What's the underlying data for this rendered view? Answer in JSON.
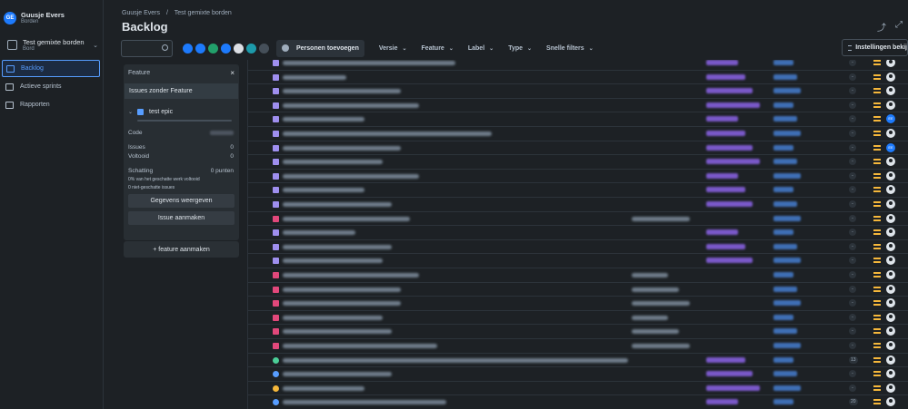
{
  "user": {
    "initials": "GE",
    "name": "Guusje Evers",
    "sub": "Borden"
  },
  "board": {
    "name": "Test gemixte borden",
    "sub": "Bord"
  },
  "nav": [
    {
      "label": "Backlog",
      "active": true
    },
    {
      "label": "Actieve sprints",
      "active": false
    },
    {
      "label": "Rapporten",
      "active": false
    }
  ],
  "breadcrumb": {
    "root": "Guusje Evers",
    "sep": "/",
    "current": "Test gemixte borden"
  },
  "page_title": "Backlog",
  "toolbar": {
    "add_people": "Personen toevoegen",
    "filters": [
      "Versie",
      "Feature",
      "Label",
      "Type",
      "Snelle filters"
    ],
    "settings": "Instellingen bekij"
  },
  "avatar_colors": [
    "#1d7afc",
    "#1d7afc",
    "#22a06b",
    "#1d7afc",
    "#dcdfe4",
    "#1d9aaa",
    "#454f59"
  ],
  "feature_panel": {
    "title": "Feature",
    "close": "×",
    "no_feature": "Issues zonder Feature",
    "epic": {
      "name": "test epic",
      "code_label": "Code",
      "issues_label": "Issues",
      "issues_value": "0",
      "done_label": "Voltooid",
      "done_value": "0",
      "estimate_label": "Schatting",
      "estimate_value": "0 punten",
      "pct_text": "0% van het geschatte werk voltooid",
      "unestimated_text": "0 niet-geschatte issues",
      "view_button": "Gegevens weergeven",
      "create_button": "Issue aanmaken"
    },
    "add_feature": "+ feature aanmaken"
  },
  "rows": [
    {
      "type": "story",
      "est": "-",
      "assignee": "default"
    },
    {
      "type": "story",
      "est": "-",
      "assignee": "default"
    },
    {
      "type": "story",
      "est": "-",
      "assignee": "default"
    },
    {
      "type": "story",
      "est": "-",
      "assignee": "default"
    },
    {
      "type": "story",
      "est": "-",
      "assignee": "EE"
    },
    {
      "type": "story",
      "est": "-",
      "assignee": "default"
    },
    {
      "type": "story",
      "est": "-",
      "assignee": "EE"
    },
    {
      "type": "story",
      "est": "-",
      "assignee": "default"
    },
    {
      "type": "story",
      "est": "-",
      "assignee": "default"
    },
    {
      "type": "story",
      "est": "-",
      "assignee": "default"
    },
    {
      "type": "story",
      "est": "-",
      "assignee": "default"
    },
    {
      "type": "bug",
      "est": "-",
      "assignee": "default"
    },
    {
      "type": "story",
      "est": "-",
      "assignee": "default"
    },
    {
      "type": "story",
      "est": "-",
      "assignee": "default"
    },
    {
      "type": "story",
      "est": "-",
      "assignee": "default"
    },
    {
      "type": "bug",
      "est": "-",
      "assignee": "default"
    },
    {
      "type": "bug",
      "est": "-",
      "assignee": "default"
    },
    {
      "type": "bug",
      "est": "-",
      "assignee": "default"
    },
    {
      "type": "bug",
      "est": "-",
      "assignee": "default"
    },
    {
      "type": "bug",
      "est": "-",
      "assignee": "default"
    },
    {
      "type": "bug",
      "est": "-",
      "assignee": "default"
    },
    {
      "type": "task",
      "est": "13",
      "assignee": "default"
    },
    {
      "type": "cloud",
      "est": "-",
      "assignee": "default"
    },
    {
      "type": "task2",
      "est": "-",
      "assignee": "default"
    },
    {
      "type": "cloud",
      "est": "20",
      "assignee": "default"
    }
  ],
  "colors": {
    "accent": "#579dff",
    "priority": "#f5b73b",
    "label": "#7a58c9",
    "bug": "#e2487b",
    "story": "#9f8fef",
    "task": "#4bce97",
    "cloud": "#579dff"
  }
}
